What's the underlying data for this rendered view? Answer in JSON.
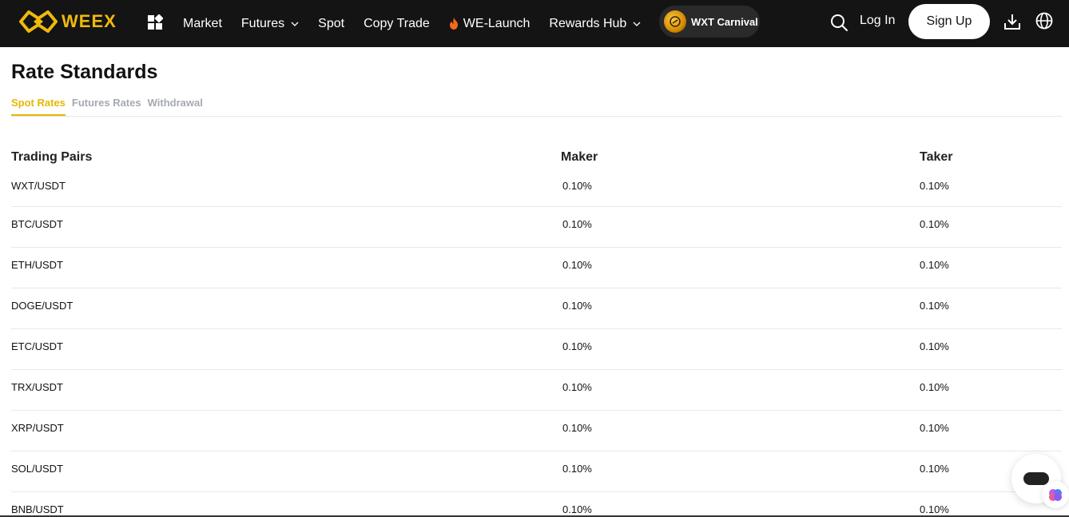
{
  "header": {
    "logo_text": "WEEX",
    "brand_color": "#F0B90B",
    "nav": [
      {
        "label": "Market",
        "has_dropdown": false
      },
      {
        "label": "Futures",
        "has_dropdown": true
      },
      {
        "label": "Spot",
        "has_dropdown": false
      },
      {
        "label": "Copy Trade",
        "has_dropdown": false
      },
      {
        "label": "WE-Launch",
        "has_dropdown": false,
        "icon": "fire-icon"
      },
      {
        "label": "Rewards Hub",
        "has_dropdown": true
      }
    ],
    "carnival_label": "WXT Carnival",
    "login_label": "Log In",
    "signup_label": "Sign Up",
    "icons": [
      "apps-icon",
      "search-icon",
      "download-icon",
      "globe-icon"
    ]
  },
  "page": {
    "title": "Rate Standards",
    "tabs": [
      {
        "label": "Spot Rates",
        "active": true
      },
      {
        "label": "Futures Rates",
        "active": false
      },
      {
        "label": "Withdrawal",
        "active": false
      }
    ],
    "accent_color": "#E6B800"
  },
  "table": {
    "headers": {
      "pair": "Trading Pairs",
      "maker": "Maker",
      "taker": "Taker"
    },
    "rows": [
      {
        "pair": "WXT/USDT",
        "maker": "0.10%",
        "taker": "0.10%"
      },
      {
        "pair": "BTC/USDT",
        "maker": "0.10%",
        "taker": "0.10%"
      },
      {
        "pair": "ETH/USDT",
        "maker": "0.10%",
        "taker": "0.10%"
      },
      {
        "pair": "DOGE/USDT",
        "maker": "0.10%",
        "taker": "0.10%"
      },
      {
        "pair": "ETC/USDT",
        "maker": "0.10%",
        "taker": "0.10%"
      },
      {
        "pair": "TRX/USDT",
        "maker": "0.10%",
        "taker": "0.10%"
      },
      {
        "pair": "XRP/USDT",
        "maker": "0.10%",
        "taker": "0.10%"
      },
      {
        "pair": "SOL/USDT",
        "maker": "0.10%",
        "taker": "0.10%"
      },
      {
        "pair": "BNB/USDT",
        "maker": "0.10%",
        "taker": "0.10%"
      }
    ]
  }
}
